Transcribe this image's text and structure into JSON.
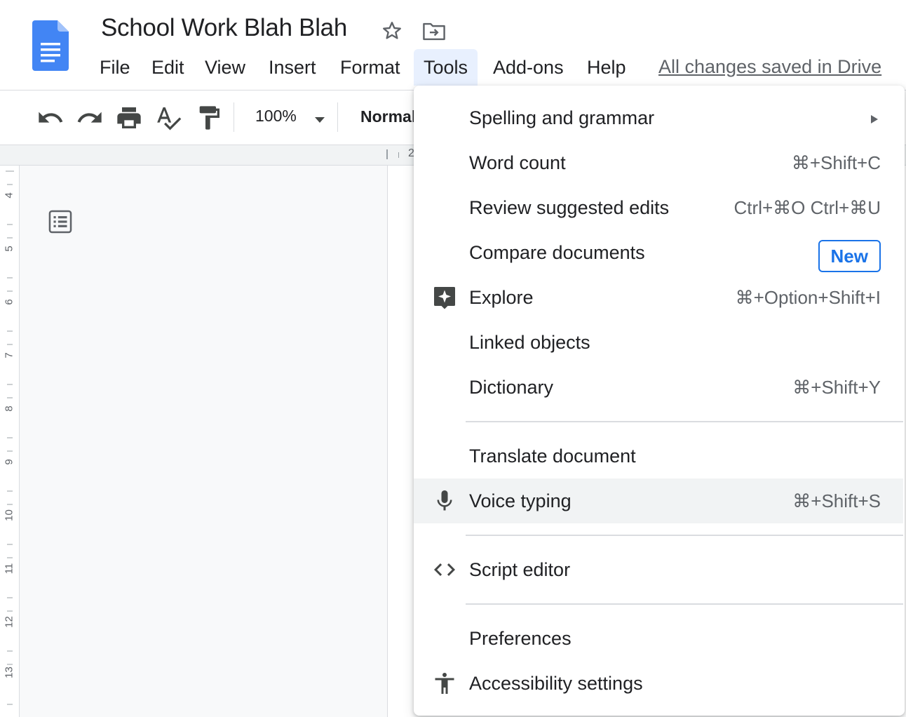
{
  "document": {
    "title": "School Work Blah Blah",
    "saved_status": "All changes saved in Drive"
  },
  "menubar": {
    "items": [
      {
        "label": "File"
      },
      {
        "label": "Edit"
      },
      {
        "label": "View"
      },
      {
        "label": "Insert"
      },
      {
        "label": "Format"
      },
      {
        "label": "Tools",
        "active": true
      },
      {
        "label": "Add-ons"
      },
      {
        "label": "Help"
      }
    ]
  },
  "toolbar": {
    "zoom": "100%",
    "style": "Normal"
  },
  "ruler": {
    "horizontal_mark": "2",
    "numbers": [
      "4",
      "5",
      "6",
      "7",
      "8",
      "9",
      "10",
      "11",
      "12",
      "13"
    ]
  },
  "tools_menu": {
    "items": [
      {
        "label": "Spelling and grammar",
        "has_submenu": true
      },
      {
        "label": "Word count",
        "shortcut": "⌘+Shift+C"
      },
      {
        "label": "Review suggested edits",
        "shortcut": "Ctrl+⌘O Ctrl+⌘U"
      },
      {
        "label": "Compare documents",
        "badge": "New"
      },
      {
        "label": "Explore",
        "shortcut": "⌘+Option+Shift+I",
        "icon": "explore-icon"
      },
      {
        "label": "Linked objects"
      },
      {
        "label": "Dictionary",
        "shortcut": "⌘+Shift+Y"
      },
      {
        "label": "Translate document"
      },
      {
        "label": "Voice typing",
        "shortcut": "⌘+Shift+S",
        "icon": "microphone-icon",
        "highlighted": true
      },
      {
        "label": "Script editor",
        "icon": "code-icon"
      },
      {
        "label": "Preferences"
      },
      {
        "label": "Accessibility settings",
        "icon": "accessibility-icon"
      }
    ]
  },
  "colors": {
    "accent": "#1a73e8",
    "doc_icon": "#4285f4",
    "active_menu_bg": "#e8f0fe",
    "hover_row_bg": "#f1f3f4"
  }
}
